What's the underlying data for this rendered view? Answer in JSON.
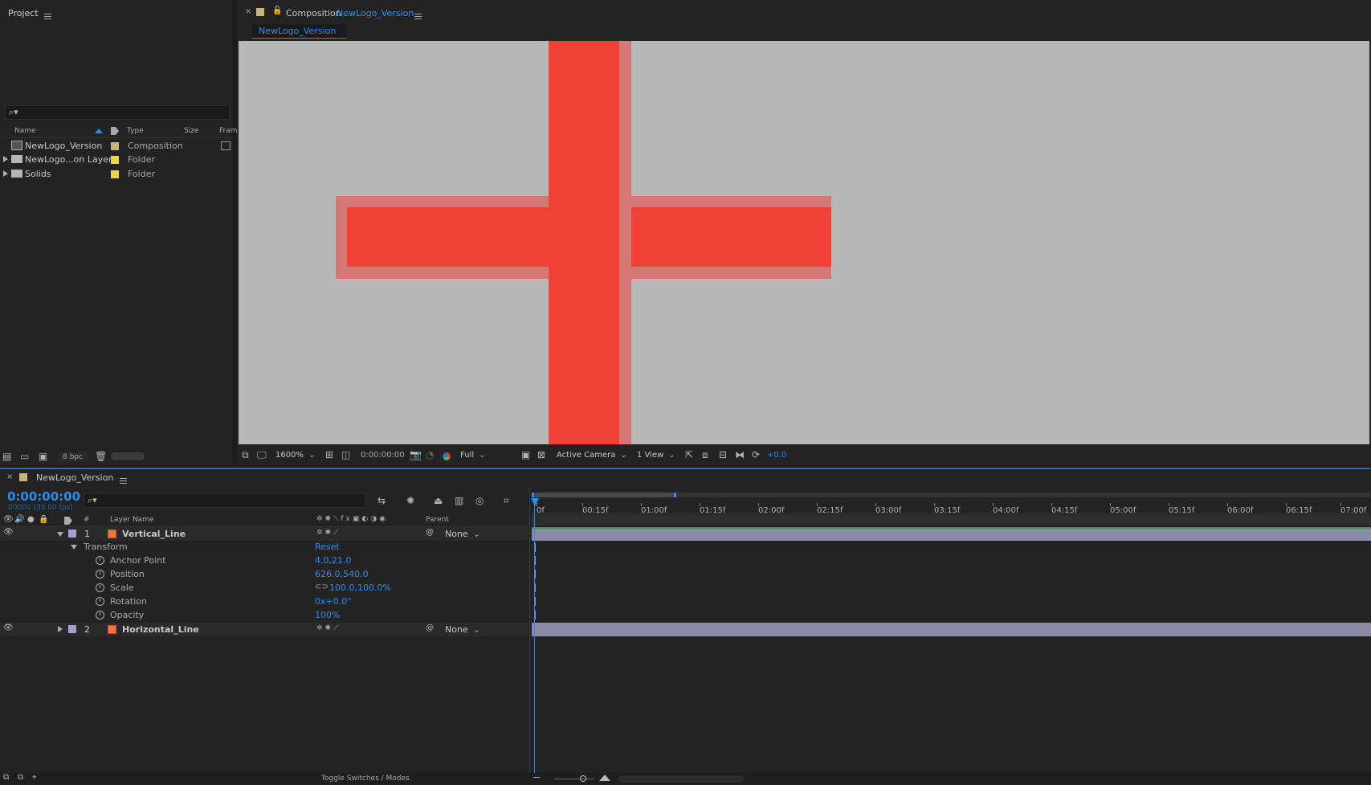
{
  "project_panel": {
    "title": "Project",
    "search_placeholder": "",
    "columns": [
      "Name",
      "Type",
      "Size",
      "Fram"
    ],
    "items": [
      {
        "name": "NewLogo_Version",
        "type": "Composition",
        "color": "#c8b37a",
        "icon": "composition-icon",
        "expandable": false
      },
      {
        "name": "NewLogo...on Layers",
        "type": "Folder",
        "color": "#e6d54a",
        "icon": "folder-icon",
        "expandable": true
      },
      {
        "name": "Solids",
        "type": "Folder",
        "color": "#e6d54a",
        "icon": "folder-icon",
        "expandable": true
      }
    ],
    "bpc": "8 bpc"
  },
  "composition_panel": {
    "title_prefix": "Composition",
    "comp_name": "NewLogo_Version",
    "tab": "NewLogo_Version",
    "viewer_bg": "#b8b8b8",
    "shape_color": "#ef4136",
    "toolbar": {
      "zoom": "1600%",
      "timecode": "0:00:00:00",
      "resolution": "Full",
      "camera": "Active Camera",
      "views": "1 View",
      "exposure": "+0.0"
    }
  },
  "timeline_panel": {
    "tab": "NewLogo_Version",
    "current_time": "0:00:00:00",
    "frame_info": "00000 (30.00 fps)",
    "columns": {
      "num": "#",
      "layer_name": "Layer Name",
      "parent": "Parent"
    },
    "ruler_ticks": [
      "0f",
      "00:15f",
      "01:00f",
      "01:15f",
      "02:00f",
      "02:15f",
      "03:00f",
      "03:15f",
      "04:00f",
      "04:15f",
      "05:00f",
      "05:15f",
      "06:00f",
      "06:15f",
      "07:00f"
    ],
    "layers": [
      {
        "num": "1",
        "name": "Vertical_Line",
        "parent": "None",
        "label_color": "#a79cd4",
        "expanded": true,
        "transform": {
          "label": "Transform",
          "reset": "Reset",
          "properties": [
            {
              "name": "Anchor Point",
              "value": "4.0,21.0"
            },
            {
              "name": "Position",
              "value": "626.0,540.0"
            },
            {
              "name": "Scale",
              "value": "100.0,100.0%"
            },
            {
              "name": "Rotation",
              "value": "0x+0.0°"
            },
            {
              "name": "Opacity",
              "value": "100%"
            }
          ]
        }
      },
      {
        "num": "2",
        "name": "Horizontal_Line",
        "parent": "None",
        "label_color": "#a79cd4",
        "expanded": false
      }
    ],
    "footer": {
      "toggle_label": "Toggle Switches / Modes"
    }
  }
}
